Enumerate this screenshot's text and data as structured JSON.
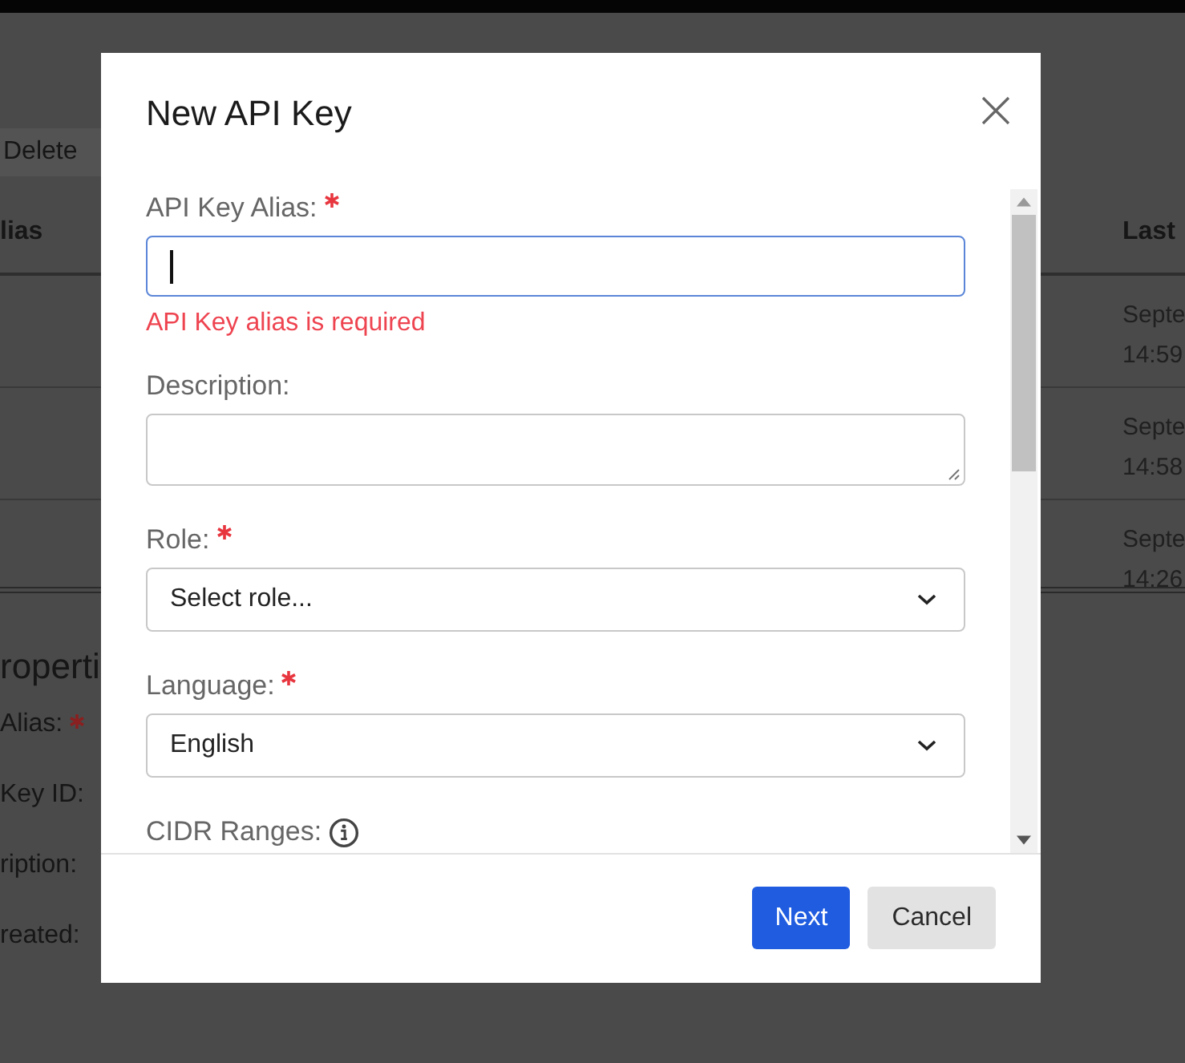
{
  "background": {
    "toolbar": {
      "button": "Delete"
    },
    "table": {
      "columns": [
        "lias",
        "Last"
      ],
      "rows": [
        {
          "column_2": [
            "Septe",
            "14:59"
          ]
        },
        {
          "column_2": [
            "Septe",
            "14:58"
          ]
        },
        {
          "column_2": [
            "Septe",
            "14:26"
          ]
        }
      ]
    },
    "properties": {
      "title": "roperti",
      "fields": [
        {
          "label": "Alias:",
          "required": true
        },
        {
          "label": "Key ID:",
          "required": false
        },
        {
          "label": "ription:",
          "required": false
        },
        {
          "label": "reated:",
          "required": false
        }
      ]
    }
  },
  "modal": {
    "title": "New API Key",
    "fields": [
      {
        "kind": "text",
        "label": "API Key Alias:",
        "required": true,
        "focused": true,
        "error": "API Key alias is required"
      },
      {
        "kind": "textarea",
        "label": "Description:",
        "required": false,
        "focused": false
      },
      {
        "kind": "select",
        "label": "Role:",
        "required": true,
        "value": "Select role..."
      },
      {
        "kind": "select",
        "label": "Language:",
        "required": true,
        "value": "English"
      },
      {
        "kind": "info",
        "label": "CIDR Ranges:",
        "required": false
      }
    ],
    "buttons": [
      {
        "label": "Next",
        "primary": true
      },
      {
        "label": "Cancel",
        "primary": false
      }
    ]
  }
}
